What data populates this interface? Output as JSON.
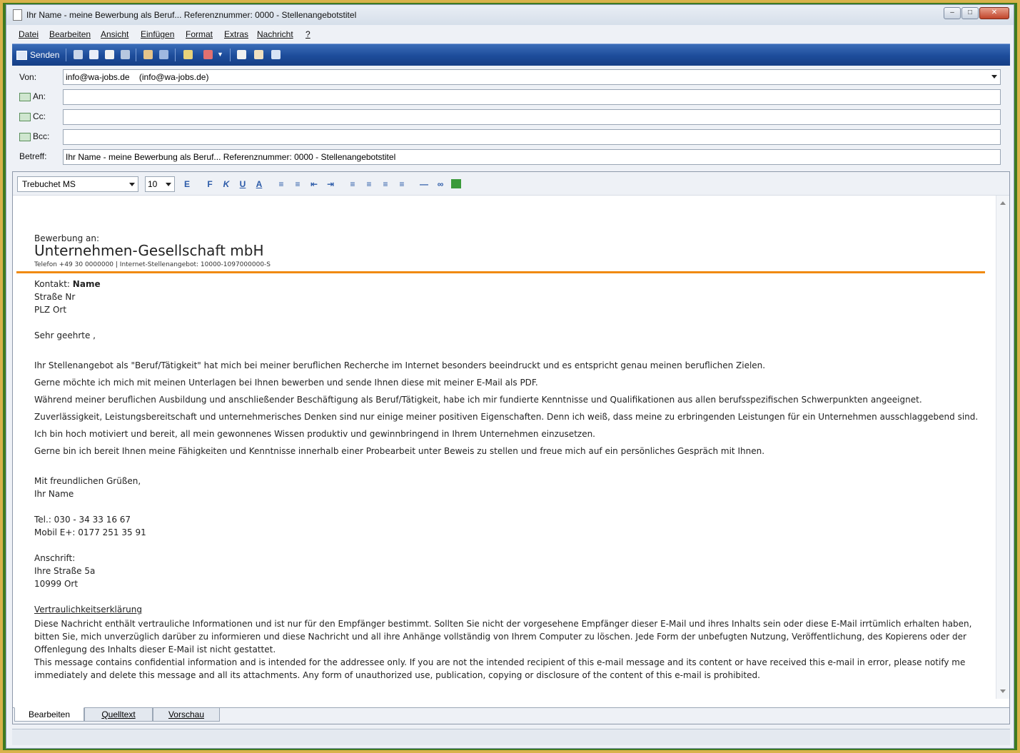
{
  "window": {
    "title": "Ihr Name - meine Bewerbung als Beruf... Referenznummer: 0000 - Stellenangebotstitel",
    "controls": {
      "minimize": "–",
      "maximize": "□",
      "close": "✕"
    }
  },
  "menu": [
    "Datei",
    "Bearbeiten",
    "Ansicht",
    "Einfügen",
    "Format",
    "Extras",
    "Nachricht",
    "?"
  ],
  "toolbar": {
    "send_label": "Senden"
  },
  "header": {
    "from_label": "Von:",
    "from_value": "info@wa-jobs.de    (info@wa-jobs.de)",
    "to_label": "An:",
    "to_value": "",
    "cc_label": "Cc:",
    "cc_value": "",
    "bcc_label": "Bcc:",
    "bcc_value": "",
    "subject_label": "Betreff:",
    "subject_value": "Ihr Name - meine Bewerbung als Beruf... Referenznummer: 0000 - Stellenangebotstitel"
  },
  "format": {
    "font": "Trebuchet MS",
    "size": "10"
  },
  "body": {
    "bewerbung_an": "Bewerbung an:",
    "company": "Unternehmen-Gesellschaft mbH",
    "company_info": "Telefon +49 30 0000000 | Internet-Stellenangebot: 10000-1097000000-S",
    "kontakt_label": "Kontakt: ",
    "kontakt_name": "Name",
    "street": "Straße Nr",
    "city": "PLZ Ort",
    "greeting": "Sehr geehrte ,",
    "paragraphs": [
      "Ihr Stellenangebot als \"Beruf/Tätigkeit\" hat mich bei meiner beruflichen Recherche im Internet besonders beeindruckt und es entspricht genau meinen beruflichen Zielen.",
      "Gerne möchte ich mich mit meinen Unterlagen bei Ihnen bewerben und sende Ihnen diese mit meiner E-Mail als PDF.",
      "Während meiner beruflichen Ausbildung und anschließender Beschäftigung als Beruf/Tätigkeit, habe ich mir fundierte Kenntnisse und Qualifikationen aus allen berufsspezifischen Schwerpunkten angeeignet.",
      "Zuverlässigkeit, Leistungsbereitschaft und unternehmerisches Denken sind nur einige meiner positiven Eigenschaften. Denn ich weiß, dass meine zu erbringenden Leistungen für ein Unternehmen ausschlaggebend sind.",
      "Ich bin hoch motiviert und bereit, all mein gewonnenes Wissen produktiv und gewinnbringend in Ihrem Unternehmen einzusetzen.",
      "Gerne bin ich bereit Ihnen meine Fähigkeiten und Kenntnisse innerhalb einer Probearbeit unter Beweis zu stellen und freue mich auf ein persönliches Gespräch mit Ihnen."
    ],
    "closing": "Mit freundlichen Grüßen,",
    "sender_name": "Ihr Name",
    "phone": "Tel.: 030 - 34 33 16 67",
    "mobile": "Mobil E+: 0177 251 35 91",
    "address_label": "Anschrift:",
    "address_street": "Ihre Straße 5a",
    "address_city": "10999 Ort",
    "confidential_title": "Vertraulichkeitserklärung",
    "confidential_de": "Diese Nachricht enthält vertrauliche Informationen und ist nur für den Empfänger bestimmt. Sollten Sie nicht der vorgesehene Empfänger dieser E-Mail und ihres Inhalts sein oder diese E-Mail irrtümlich erhalten haben, bitten Sie, mich unverzüglich darüber zu informieren und diese Nachricht und all ihre Anhänge vollständig von Ihrem Computer zu löschen. Jede Form der unbefugten Nutzung, Veröffentlichung, des Kopierens oder der Offenlegung des Inhalts dieser E-Mail ist nicht gestattet.",
    "confidential_en": "This message contains confidential information and is intended for the addressee only. If you are not the intended recipient of this e-mail message and its content or have received this e-mail in error, please notify me immediately and delete this message and all its attachments. Any form of unauthorized use, publication, copying or disclosure of the content of this e-mail is prohibited."
  },
  "tabs": [
    "Bearbeiten",
    "Quelltext",
    "Vorschau"
  ],
  "colors": {
    "toolbar": "#1d4c9a",
    "divider": "#f08a10"
  }
}
